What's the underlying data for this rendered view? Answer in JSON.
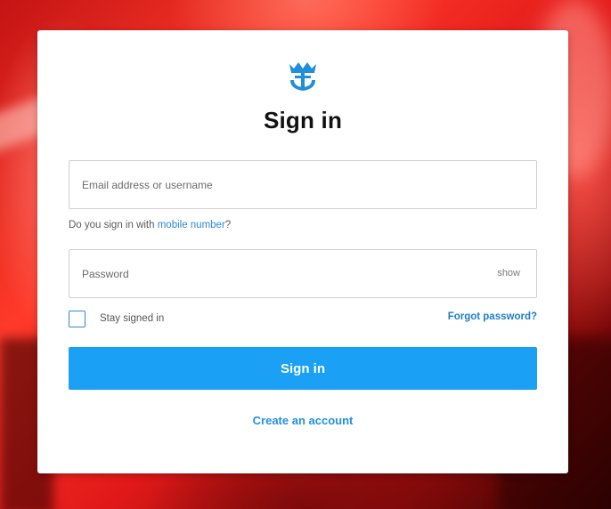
{
  "page": {
    "title": "Sign in"
  },
  "brand": {
    "logo_icon": "crown-anchor-icon",
    "accent_color": "#1aa0f4"
  },
  "form": {
    "email_placeholder": "Email address or username",
    "email_value": "",
    "mobile_hint_prefix": "Do you sign in with ",
    "mobile_hint_link": "mobile number",
    "mobile_hint_suffix": "?",
    "password_placeholder": "Password",
    "password_value": "",
    "show_label": "show",
    "stay_signed_in_label": "Stay signed in",
    "stay_signed_in_checked": false,
    "forgot_password_label": "Forgot password?",
    "submit_label": "Sign in",
    "create_account_label": "Create an account"
  }
}
